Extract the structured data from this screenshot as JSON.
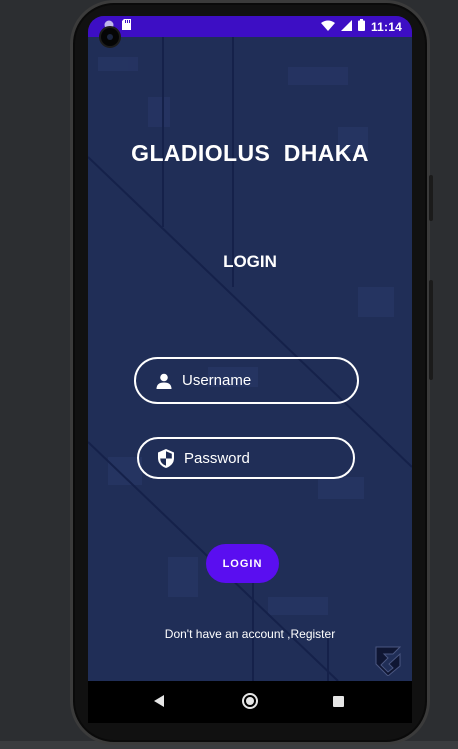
{
  "status_bar": {
    "time": "11:14",
    "left_icons": [
      "circle-notification-icon",
      "sd-card-icon"
    ],
    "right_icons": [
      "wifi-icon",
      "signal-icon",
      "battery-icon"
    ],
    "color": "#3d0ec4"
  },
  "app": {
    "title": "GLADIOLUS  DHAKA",
    "subtitle": "LOGIN",
    "username": {
      "placeholder": "Username",
      "value": "",
      "icon": "person-icon"
    },
    "password": {
      "placeholder": "Password",
      "value": "",
      "icon": "shield-icon"
    },
    "login_button": "LOGIN",
    "register_link": "Don't have an account ,Register",
    "background_color": "#1e2c54",
    "accent_color": "#5a0ef0"
  },
  "nav_bar": {
    "icons": [
      "back-icon",
      "home-icon",
      "recents-icon"
    ]
  }
}
